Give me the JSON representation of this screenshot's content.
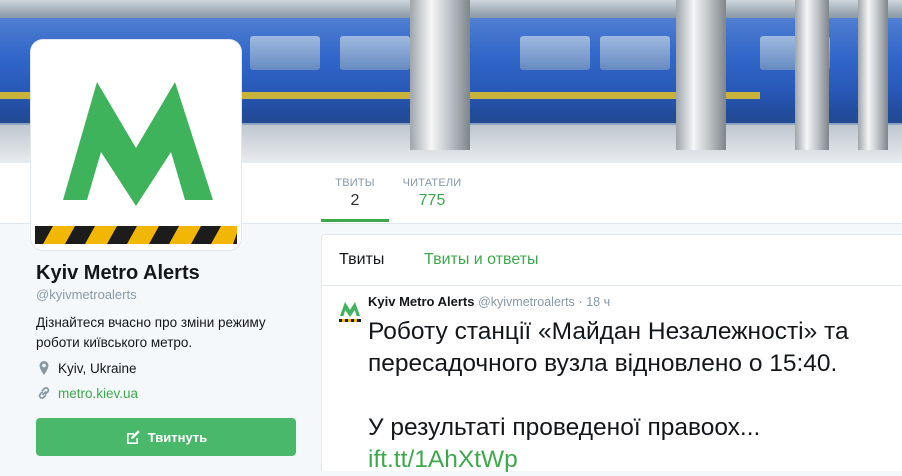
{
  "profile": {
    "name": "Kyiv Metro Alerts",
    "handle": "@kyivmetroalerts",
    "bio": "Дізнайтеся вчасно про зміни режиму роботи київського метро.",
    "location": "Kyiv, Ukraine",
    "url": "metro.kiev.ua",
    "tweet_button": "Твитнуть"
  },
  "stats": {
    "tweets_label": "ТВИТЫ",
    "tweets_count": "2",
    "followers_label": "ЧИТАТЕЛИ",
    "followers_count": "775"
  },
  "tabs": {
    "tweets": "Твиты",
    "tweets_replies": "Твиты и ответы"
  },
  "tweet": {
    "name": "Kyiv Metro Alerts",
    "handle": "@kyivmetroalerts",
    "separator": "·",
    "time": "18 ч",
    "line1": "Роботу станції «Майдан Незалежності» та пересадочного вузла відновлено о 15:40.",
    "line2_text": "У результаті проведеної правоох... ",
    "line2_link": "ift.tt/1AhXtWp"
  },
  "colors": {
    "brand_green": "#3ea84d",
    "button_green": "#4ab86b",
    "logo_green": "#3fb35b",
    "logo_stripe_yellow": "#f2b705"
  },
  "icons": {
    "location": "map-pin-icon",
    "link": "link-icon",
    "compose": "compose-icon",
    "logo": "metro-m-logo"
  }
}
